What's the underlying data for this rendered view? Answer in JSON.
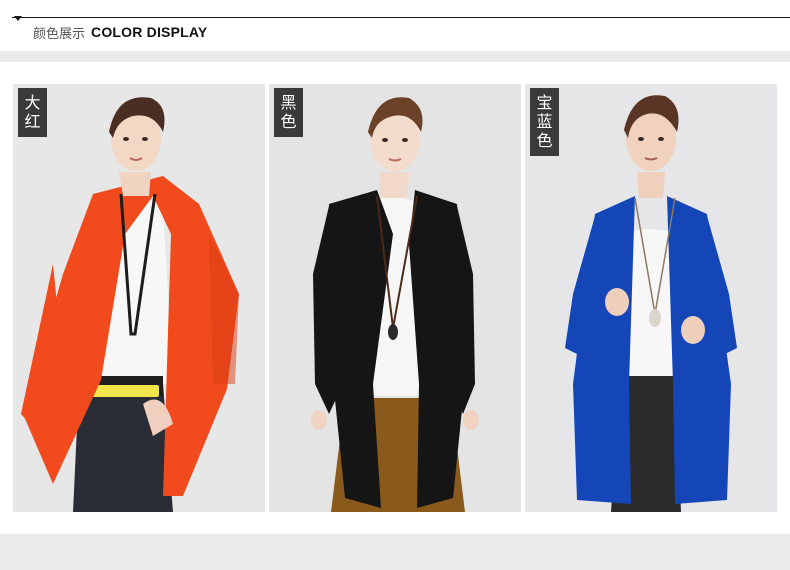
{
  "header": {
    "title_cn": "颜色展示",
    "title_en": "COLOR DISPLAY"
  },
  "gallery": {
    "items": [
      {
        "tag": [
          "大",
          "红"
        ],
        "color": "#f04a1d"
      },
      {
        "tag": [
          "黑",
          "色"
        ],
        "color": "#151515"
      },
      {
        "tag": [
          "宝",
          "蓝",
          "色"
        ],
        "color": "#1446b8"
      }
    ]
  }
}
